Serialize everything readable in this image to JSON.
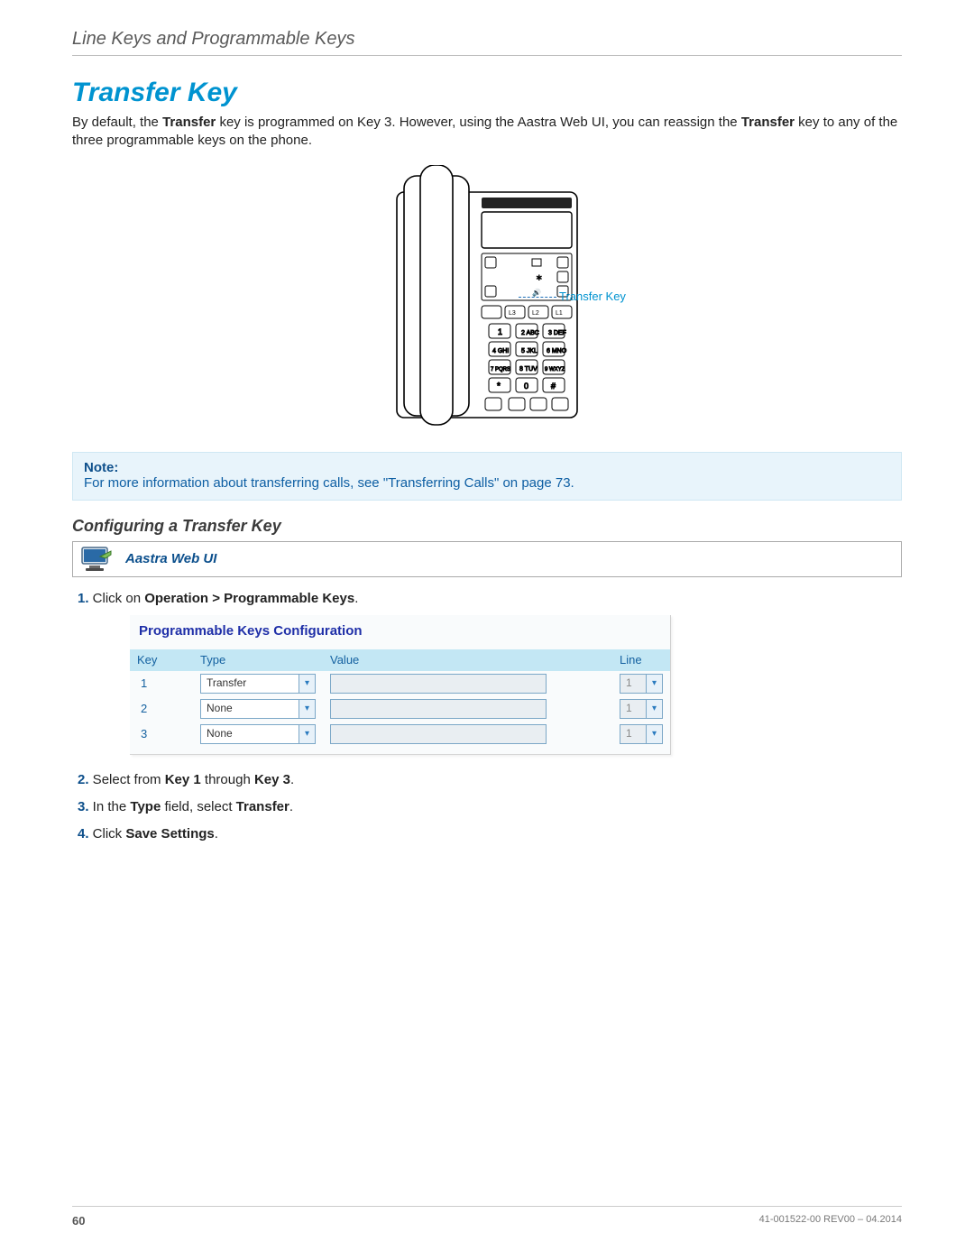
{
  "section_header": "Line Keys and Programmable Keys",
  "title": "Transfer Key",
  "intro_prefix": "By default, the ",
  "intro_bold1": "Transfer",
  "intro_mid1": " key is programmed on Key 3. However, using the Aastra Web UI, you can reassign the ",
  "intro_bold2": "Transfer",
  "intro_suffix": " key to any of the three programmable keys on the phone.",
  "phone_label": "Transfer Key",
  "note_label": "Note:",
  "note_text_prefix": "For more information about transferring calls, see ",
  "note_link_text": "\"Transferring Calls\"",
  "note_text_mid": " on ",
  "note_page_link": "page 73",
  "note_text_suffix": ".",
  "subheading": "Configuring a Transfer Key",
  "webui_label": "Aastra Web UI",
  "steps": {
    "s1_num": "1.",
    "s1_pre": " Click on ",
    "s1_bold": "Operation > Programmable Keys",
    "s1_post": ".",
    "s2_num": "2.",
    "s2_pre": " Select from ",
    "s2_b1": "Key 1",
    "s2_mid": " through ",
    "s2_b2": "Key 3",
    "s2_post": ".",
    "s3_num": "3.",
    "s3_pre": " In the ",
    "s3_b1": "Type",
    "s3_mid": " field, select ",
    "s3_b2": "Transfer",
    "s3_post": ".",
    "s4_num": "4.",
    "s4_pre": " Click ",
    "s4_bold": "Save Settings",
    "s4_post": "."
  },
  "config": {
    "title": "Programmable Keys Configuration",
    "headers": {
      "key": "Key",
      "type": "Type",
      "value": "Value",
      "line": "Line"
    },
    "rows": [
      {
        "key": "1",
        "type": "Transfer",
        "value": "",
        "line": "1"
      },
      {
        "key": "2",
        "type": "None",
        "value": "",
        "line": "1"
      },
      {
        "key": "3",
        "type": "None",
        "value": "",
        "line": "1"
      }
    ]
  },
  "footer": {
    "page": "60",
    "doc": "41-001522-00 REV00 – 04.2014"
  }
}
